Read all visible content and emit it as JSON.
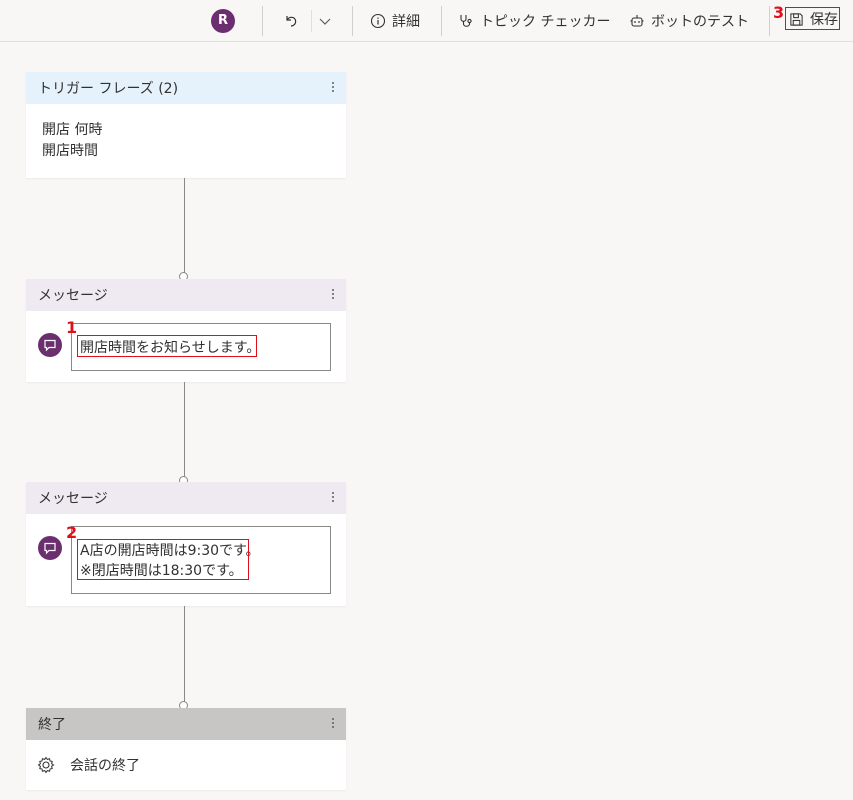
{
  "toolbar": {
    "avatar_initial": "R",
    "detail_label": "詳細",
    "topic_checker_label": "トピック チェッカー",
    "bot_test_label": "ボットのテスト",
    "save_label": "保存"
  },
  "annotations": {
    "one": "1",
    "two": "2",
    "three": "3"
  },
  "nodes": {
    "trigger": {
      "title": "トリガー フレーズ (2)",
      "phrases": [
        "開店 何時",
        "開店時間"
      ]
    },
    "message1": {
      "title": "メッセージ",
      "text": "開店時間をお知らせします。"
    },
    "message2": {
      "title": "メッセージ",
      "line1": "A店の開店時間は9:30です。",
      "line2": "※閉店時間は18:30です。"
    },
    "end": {
      "title": "終了",
      "action": "会話の終了"
    }
  },
  "colors": {
    "accent_purple": "#6b2f6f",
    "highlight_red": "#e0101a",
    "trigger_header": "#e5f1fb",
    "message_header": "#efe9f1",
    "end_header": "#c8c6c4"
  }
}
